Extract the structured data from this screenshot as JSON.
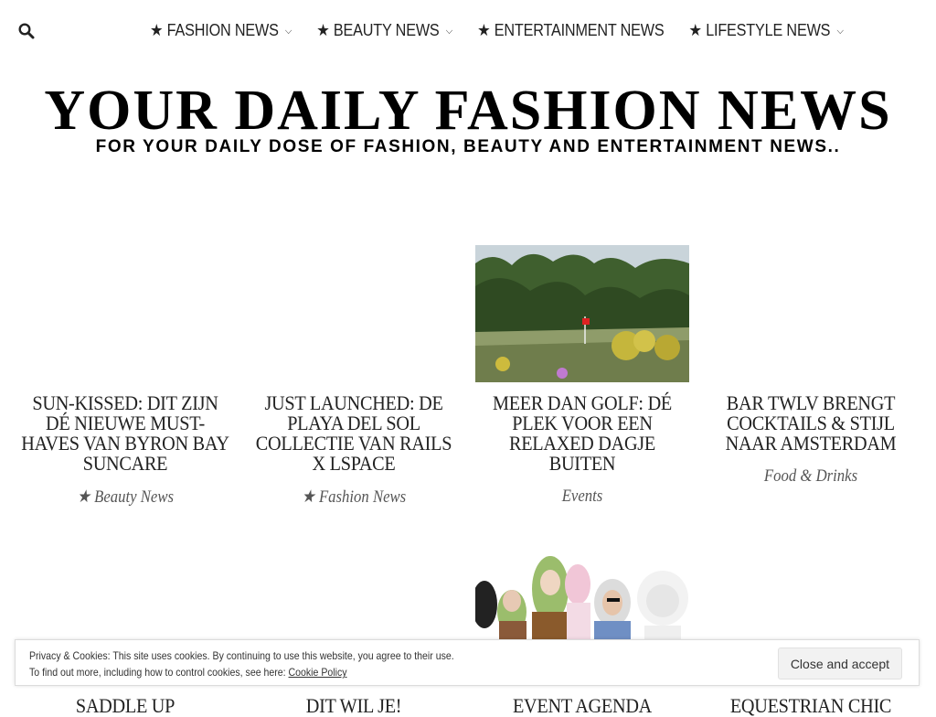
{
  "nav": {
    "items": [
      {
        "label": "★ FASHION NEWS",
        "chevron": "⌵"
      },
      {
        "label": "★ BEAUTY NEWS",
        "chevron": "⌵"
      },
      {
        "label": "★ ENTERTAINMENT NEWS"
      },
      {
        "label": "★ LIFESTYLE NEWS",
        "chevron": "⌵"
      }
    ]
  },
  "site": {
    "title": "YOUR DAILY FASHION NEWS",
    "tagline": "FOR YOUR DAILY DOSE OF FASHION, BEAUTY AND ENTERTAINMENT NEWS.."
  },
  "posts": [
    {
      "title": "SUN-KISSED: DIT ZIJN DÉ NIEUWE MUST-HAVES VAN BYRON BAY SUNCARE",
      "category": "★ Beauty News"
    },
    {
      "title": "JUST LAUNCHED: DE PLAYA DEL SOL COLLECTIE VAN RAILS X LSPACE",
      "category": "★ Fashion News"
    },
    {
      "title": "MEER DAN GOLF: DÉ PLEK VOOR EEN RELAXED DAGJE BUITEN",
      "category": "Events"
    },
    {
      "title": "BAR TWLV BRENGT COCKTAILS & STIJL NAAR AMSTERDAM",
      "category": "Food & Drinks"
    },
    {
      "title": "SADDLE UP",
      "category": ""
    },
    {
      "title": "DIT WIL JE!",
      "category": ""
    },
    {
      "title": "EVENT AGENDA",
      "category": ""
    },
    {
      "title": "EQUESTRIAN CHIC",
      "category": ""
    }
  ],
  "cookie": {
    "line1": "Privacy & Cookies: This site uses cookies. By continuing to use this website, you agree to their use.",
    "line2": "To find out more, including how to control cookies, see here:",
    "link": "Cookie Policy",
    "button": "Close and accept"
  },
  "icons": {
    "search": "search-icon"
  }
}
